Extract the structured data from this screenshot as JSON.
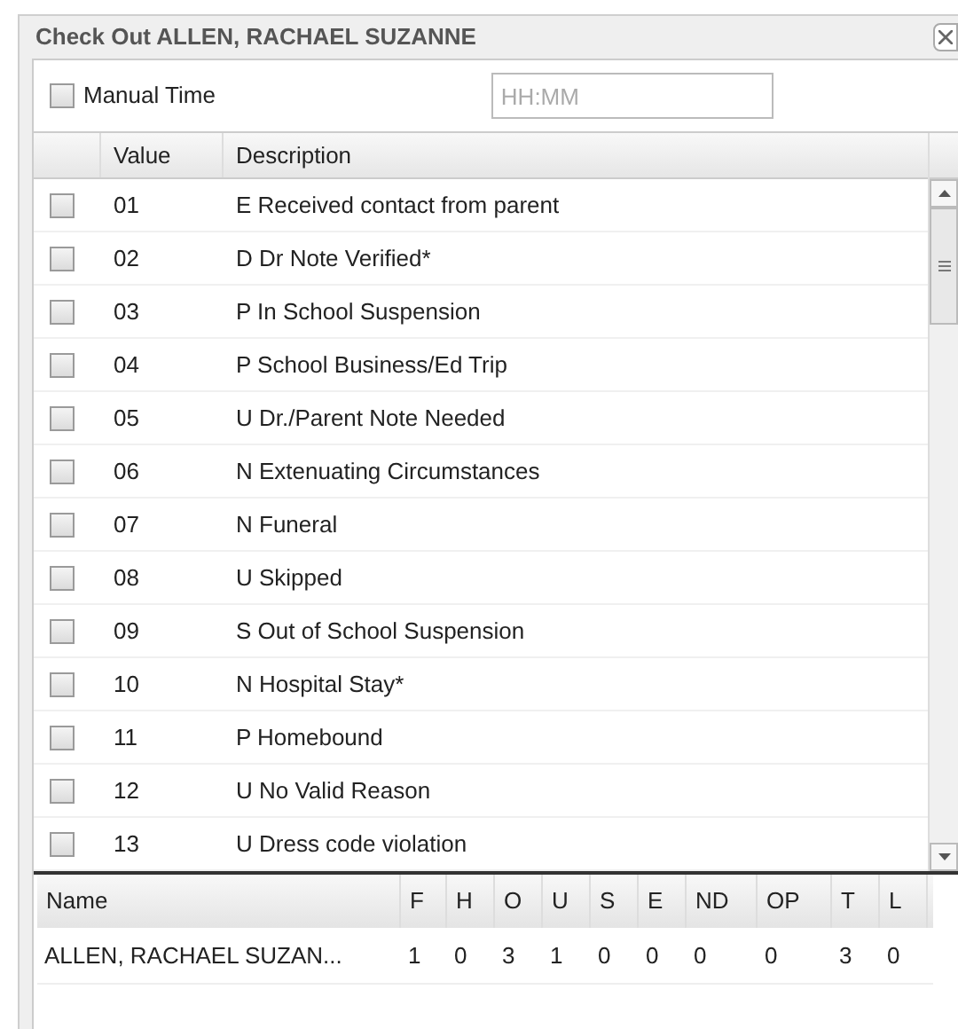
{
  "dialog": {
    "title": "Check Out ALLEN, RACHAEL SUZANNE"
  },
  "manual_time": {
    "label": "Manual Time",
    "checked": false,
    "placeholder": "HH:MM"
  },
  "codes_table": {
    "columns": [
      "Value",
      "Description"
    ],
    "rows": [
      {
        "value": "01",
        "description": "E Received contact from parent",
        "checked": false
      },
      {
        "value": "02",
        "description": "D Dr Note Verified*",
        "checked": false
      },
      {
        "value": "03",
        "description": "P In School Suspension",
        "checked": false
      },
      {
        "value": "04",
        "description": "P School Business/Ed Trip",
        "checked": false
      },
      {
        "value": "05",
        "description": "U Dr./Parent Note Needed",
        "checked": false
      },
      {
        "value": "06",
        "description": "N Extenuating Circumstances",
        "checked": false
      },
      {
        "value": "07",
        "description": "N Funeral",
        "checked": false
      },
      {
        "value": "08",
        "description": "U Skipped",
        "checked": false
      },
      {
        "value": "09",
        "description": "S Out of School Suspension",
        "checked": false
      },
      {
        "value": "10",
        "description": "N Hospital Stay*",
        "checked": false
      },
      {
        "value": "11",
        "description": "P Homebound",
        "checked": false
      },
      {
        "value": "12",
        "description": "U No Valid Reason",
        "checked": false
      },
      {
        "value": "13",
        "description": "U Dress code violation",
        "checked": false
      }
    ]
  },
  "summary_table": {
    "columns": [
      "Name",
      "F",
      "H",
      "O",
      "U",
      "S",
      "E",
      "ND",
      "OP",
      "T",
      "L"
    ],
    "rows": [
      [
        "ALLEN, RACHAEL SUZAN...",
        "1",
        "0",
        "3",
        "1",
        "0",
        "0",
        "0",
        "0",
        "3",
        "0"
      ]
    ]
  }
}
